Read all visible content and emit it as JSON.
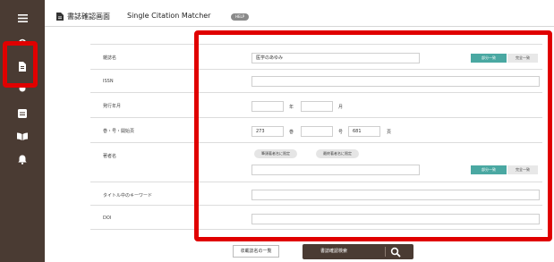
{
  "sidebar": {
    "icons": [
      "menu-icon",
      "search-icon",
      "document-icon",
      "circle-icon",
      "card-icon",
      "book-icon",
      "bell-icon"
    ]
  },
  "header": {
    "title": "書誌確認画面",
    "tab": "Single Citation Matcher",
    "help": "HELP"
  },
  "form": {
    "journal": {
      "label": "雑誌名",
      "value": "医学のあゆみ",
      "btn_partial": "部分一致",
      "btn_exact": "完全一致"
    },
    "issn": {
      "label": "ISSN",
      "value": ""
    },
    "pubdate": {
      "label": "発行年月",
      "year_unit": "年",
      "month_unit": "月"
    },
    "vip": {
      "label": "巻・号・開始頁",
      "volume": "273",
      "volume_unit": "巻",
      "issue_unit": "号",
      "page": "681",
      "page_unit": "頁"
    },
    "author": {
      "label": "著者名",
      "first_author_btn": "筆頭著者名に限定",
      "last_author_btn": "最終著者名に限定",
      "btn_partial": "部分一致",
      "btn_exact": "完全一致"
    },
    "keyword": {
      "label": "タイトル中のキーワード",
      "value": ""
    },
    "doi": {
      "label": "DOI",
      "value": ""
    }
  },
  "footer": {
    "journal_list": "収載誌名の一覧",
    "search": "書誌確認検索"
  },
  "highlight_color": "#e00000",
  "accent_color": "#4aa8a2",
  "sidebar_color": "#4a3b33"
}
